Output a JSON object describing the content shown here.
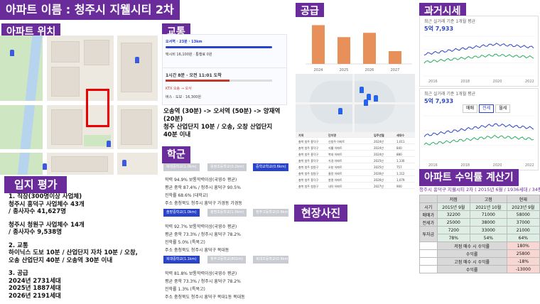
{
  "title": "아파트 이름 : 청주시 지웰시티 2차",
  "sections": {
    "location": "아파트 위치",
    "transport": "교통",
    "school": "학군",
    "supply": "공급",
    "price": "과거시세",
    "eval": "입지 평가",
    "photo": "현장사진",
    "yield": "아파트 수익률 계산기"
  },
  "location_eval": [
    "1. 직장(300명이상 사업체)",
    "청주시 흥덕구 사업체수 43개",
    "/ 종사자수 41,627명",
    "",
    "청주시 청원구 사업체수 14개",
    "/ 종사자수 9,538명",
    "",
    "2. 교통",
    "하이닉스 도보 10분 / 산업단지 자차 10분 / 오창,",
    "오송 산업단지 40분 / 오송역 30분 이내",
    "",
    "3. 공급",
    "2024년 2731세대",
    "2025년 1887세대",
    "2026년 2191세대"
  ],
  "transport": {
    "lines": [
      "오송역 (30분) -> 오서역 (50분) -> 양재역",
      "(20분)",
      "청주 산업단지 10분 / 오송, 오창 산업단지",
      "40분 이내"
    ],
    "map_rows": [
      {
        "label": "오서역 · 23분 · 13km",
        "color": "#2a44c9"
      },
      {
        "label": "택시비 16,100원 · 통행료 0원",
        "color": "#555"
      },
      {
        "label": "1시간 8분 · 오전 11:01 도착",
        "color": "#111"
      },
      {
        "label": "KTX 오송 → 오서",
        "color": "#c0392b"
      },
      {
        "label": "버스 · 도보 · 16,300원",
        "color": "#555"
      }
    ]
  },
  "school": {
    "groups": [
      {
        "tags": [
          "복대중학교(1.0km)",
          "용정초등학교(0.2km)",
          "중학교학교(0.6km)"
        ],
        "lines": [
          "학력 94.9% 보통학력이상(국영수 평균)",
          "평균 중학 87.4% / 청주시 흥덕구 90.5%",
          "진학률 68.6% (대학교)",
          "주소 충청북도 청주시 흥덕구 가경동 가경동"
        ]
      },
      {
        "tags": [
          "솔밭중학교(1.0km)",
          "봉명초등학교(1.0km)",
          "청주고등학교(0.9km)"
        ],
        "lines": [
          "학력 92.7% 보통학력이상(국영수 평균)",
          "평균 중학 73.3% / 청주시 흥덕구 78.2%",
          "진학률 5.0% (특목고)",
          "주소 충청북도 청주시 흥덕구 복대동"
        ]
      },
      {
        "tags": [
          "복대중학교(1.1km)",
          "청주고등학교(802m)",
          "복대초등학교(0.9km)"
        ],
        "lines": [
          "학력 81.8% 보통학력이상(국영수 평균)",
          "평균 중학 73.3% / 청주시 흥덕구 78.2%",
          "진학률 1.3% (특목고)",
          "주소 충청북도 청주시 흥덕구 복대1동 복대동"
        ]
      }
    ]
  },
  "supply_chart": {
    "categories": [
      "2024",
      "2025",
      "2026",
      "2027"
    ],
    "values": [
      2731,
      1887,
      2191,
      900
    ],
    "color": "#e8905a"
  },
  "price": {
    "chart1": {
      "caption": "최근 실거래 기준 1개월 평균",
      "value": "5억 7,933",
      "tabs": [
        "매매",
        "전세",
        "월세"
      ]
    },
    "chart2": {
      "caption": "최근 실거래 기준 1개월 평균",
      "value": "5억 7,933",
      "tabs": [
        "매매",
        "전세",
        "월세"
      ]
    },
    "years": [
      "2016",
      "2018",
      "2020",
      "2022"
    ]
  },
  "yield_calc": {
    "title": "청주시 흥덕구 지웰시티 2차 ( 2015년 6월 / 1936세대 / 34평)",
    "head": [
      "",
      "저점",
      "고점",
      "현재"
    ],
    "rows": [
      [
        "시기",
        "2015년 9월",
        "2021년 10월",
        "2023년 9월"
      ],
      [
        "매매가",
        "32200",
        "71000",
        "58000"
      ],
      [
        "전세가",
        "25000",
        "38000",
        "37000"
      ]
    ],
    "gap_label": "투자금",
    "gap_rows": [
      [
        "7200",
        "33000",
        "21000"
      ],
      [
        "78%",
        "54%",
        "64%"
      ]
    ],
    "summary": [
      [
        "저점 매수 시 수익률",
        "180%"
      ],
      [
        "수익률",
        "25800"
      ],
      [
        "고점 매수 시 수익률",
        "-18%"
      ],
      [
        "수익률",
        "-13000"
      ]
    ]
  }
}
